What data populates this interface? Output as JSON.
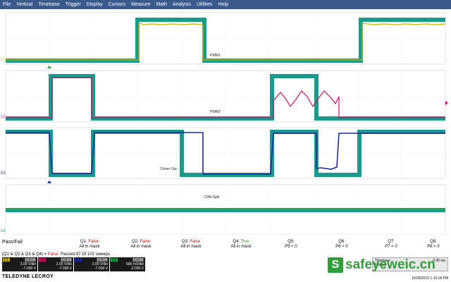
{
  "menu": [
    "File",
    "Vertical",
    "Timebase",
    "Trigger",
    "Display",
    "Cursors",
    "Measure",
    "Math",
    "Analysis",
    "Utilities",
    "Help"
  ],
  "colors": {
    "mask": "#1a9a8a",
    "c1": "#c8b400",
    "c2": "#cc1166",
    "c3": "#1a2aa0",
    "c4": "#22aa44",
    "grid": "#888888",
    "menubar": "#3a5a8c"
  },
  "traces": {
    "c1": {
      "label": "PWM1",
      "channel_tag": "C1"
    },
    "c2": {
      "label": "PWM2",
      "channel_tag": "C2"
    },
    "c3": {
      "label": "Driver Out",
      "channel_tag": "C3"
    },
    "c4": {
      "label": "CAN Split",
      "channel_tag": "C4"
    }
  },
  "grid_markers": {
    "g1": "G1",
    "g2": "G2",
    "g3": "G3",
    "g4": "G4"
  },
  "measure": {
    "pass_fail_title": "Pass/Fail",
    "conditions": [
      {
        "name": "Q1:",
        "result": "False",
        "detail": "All in mask",
        "state": "false"
      },
      {
        "name": "Q2:",
        "result": "False",
        "detail": "All in mask",
        "state": "false"
      },
      {
        "name": "Q3:",
        "result": "False",
        "detail": "All in mask",
        "state": "false"
      },
      {
        "name": "Q4:",
        "result": "True",
        "detail": "All in mask",
        "state": "true"
      },
      {
        "name": "Q5:",
        "result": "",
        "detail": "P5 < 0",
        "state": ""
      },
      {
        "name": "Q6:",
        "result": "",
        "detail": "P6 < 0",
        "state": ""
      },
      {
        "name": "Q7:",
        "result": "",
        "detail": "P7 < 0",
        "state": ""
      },
      {
        "name": "Q8:",
        "result": "",
        "detail": "P8 < 0",
        "state": ""
      }
    ],
    "logic_expr": "(Q1 & Q2 & Q3 & Q4) =",
    "logic_result": "False",
    "passed_text": "Passed  97   Of  102   sweeps"
  },
  "channels": [
    {
      "tag": "C1",
      "coupling": "DC1M",
      "vdiv": "2.00 V/div",
      "offset": "-7.000 V",
      "color": "#c8b400"
    },
    {
      "tag": "C2",
      "coupling": "DC1M",
      "vdiv": "2.00 V/div",
      "offset": "-7.000 V",
      "color": "#cc1166"
    },
    {
      "tag": "C3",
      "coupling": "DC1M",
      "vdiv": "2.00 V/div",
      "offset": "-7.000 V",
      "color": "#1a2aa0"
    },
    {
      "tag": "C4",
      "coupling": "DC1M",
      "vdiv": "500 mV/div",
      "offset": "-2.000 V",
      "color": "#22aa44"
    }
  ],
  "timebase": {
    "label": "Timebase",
    "value": "0.00 ms",
    "row2": "Normal"
  },
  "brand": "TELEDYNE LECROY",
  "timestamp": "10/26/2015  1:10:18 PM",
  "watermark": {
    "icon": "S",
    "text": "safeyeweic.cn"
  }
}
